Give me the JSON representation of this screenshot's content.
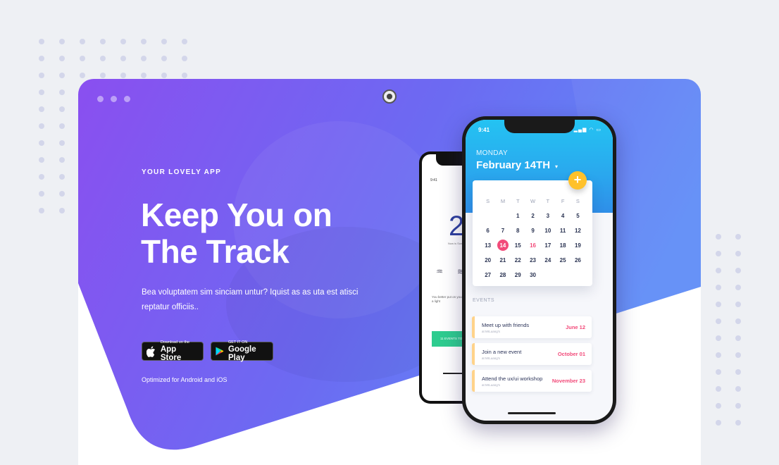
{
  "hero": {
    "eyebrow": "YOUR LOVELY APP",
    "headline": "Keep You on The Track",
    "lead": "Bea voluptatem sim sinciam untur? Iquist as as uta est atisci reptatur officiis..",
    "optimized": "Optimized for Android and iOS"
  },
  "stores": {
    "apple_small": "Download on the",
    "apple_big": "App Store",
    "google_small": "GET IT ON",
    "google_big": "Google Play"
  },
  "back_phone": {
    "time": "9:41",
    "big_number": "2",
    "sub": "Now is Sun Fri",
    "text": "You better put on your umbrella, as a light",
    "button": "11 EVENTS TO G"
  },
  "front_phone": {
    "time": "9:41",
    "status": "▂▄▆ ◠ ▭",
    "day": "MONDAY",
    "date": "February 14TH",
    "caret": "▾",
    "add": "+",
    "weekdays": [
      "S",
      "M",
      "T",
      "W",
      "T",
      "F",
      "S"
    ],
    "weeks": [
      [
        "",
        "",
        "1",
        "2",
        "3",
        "4",
        "5"
      ],
      [
        "6",
        "7",
        "8",
        "9",
        "10",
        "11",
        "12"
      ],
      [
        "13",
        "14",
        "15",
        "16",
        "17",
        "18",
        "19"
      ],
      [
        "20",
        "21",
        "22",
        "23",
        "24",
        "25",
        "26"
      ],
      [
        "27",
        "28",
        "29",
        "30",
        "",
        "",
        ""
      ]
    ],
    "selected_day": "14",
    "highlight_day": "16",
    "events_label": "EVENTS",
    "events": [
      {
        "title": "Meet up with friends",
        "sub": "at MrLuang's",
        "date": "June 12"
      },
      {
        "title": "Join a new event",
        "sub": "at MrLuang's",
        "date": "October 01"
      },
      {
        "title": "Attend the ux/ui workshop",
        "sub": "at MrLuang's",
        "date": "November 23"
      }
    ]
  },
  "colors": {
    "gradient_start": "#8a4ff0",
    "gradient_end": "#5f8df7",
    "accent_pink": "#f24b7a",
    "accent_yellow": "#ffc12b"
  }
}
